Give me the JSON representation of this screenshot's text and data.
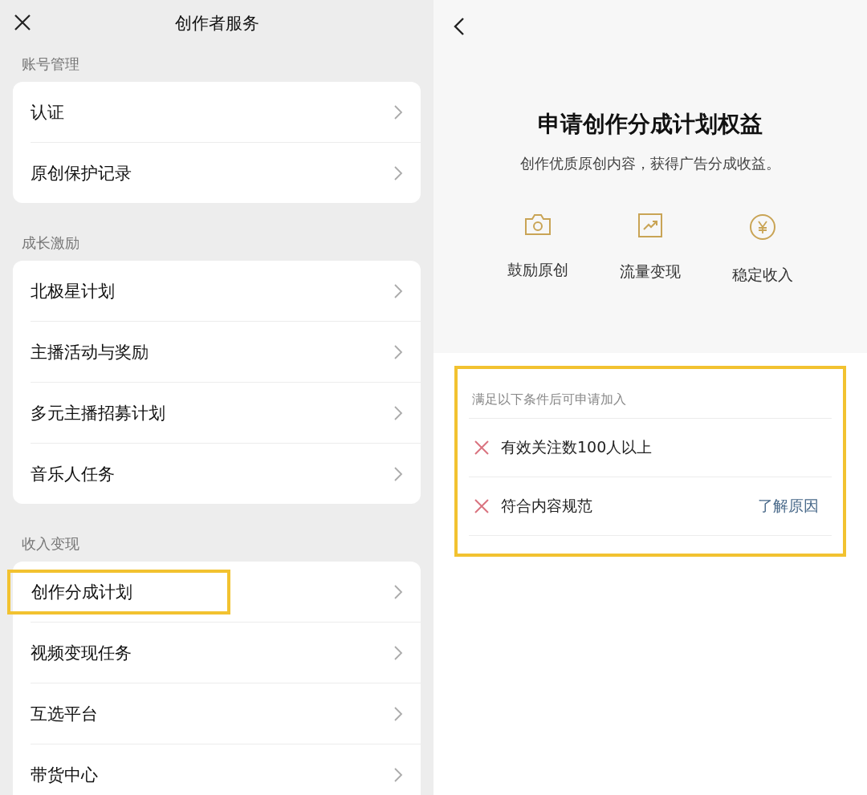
{
  "left_panel": {
    "title": "创作者服务",
    "sections": [
      {
        "label": "账号管理",
        "items": [
          {
            "label": "认证",
            "highlighted": false
          },
          {
            "label": "原创保护记录",
            "highlighted": false
          }
        ]
      },
      {
        "label": "成长激励",
        "items": [
          {
            "label": "北极星计划",
            "highlighted": false
          },
          {
            "label": "主播活动与奖励",
            "highlighted": false
          },
          {
            "label": "多元主播招募计划",
            "highlighted": false
          },
          {
            "label": "音乐人任务",
            "highlighted": false
          }
        ]
      },
      {
        "label": "收入变现",
        "items": [
          {
            "label": "创作分成计划",
            "highlighted": true
          },
          {
            "label": "视频变现任务",
            "highlighted": false
          },
          {
            "label": "互选平台",
            "highlighted": false
          },
          {
            "label": "带货中心",
            "highlighted": false
          }
        ]
      }
    ]
  },
  "right_panel": {
    "heading": "申请创作分成计划权益",
    "subtitle": "创作优质原创内容，获得广告分成收益。",
    "benefits": [
      {
        "label": "鼓励原创"
      },
      {
        "label": "流量变现"
      },
      {
        "label": "稳定收入"
      }
    ],
    "requirements": {
      "highlighted": true,
      "intro": "满足以下条件后可申请加入",
      "items": [
        {
          "label": "有效关注数100人以上",
          "met": false
        },
        {
          "label": "符合内容规范",
          "met": false,
          "link": "了解原因"
        }
      ]
    }
  }
}
